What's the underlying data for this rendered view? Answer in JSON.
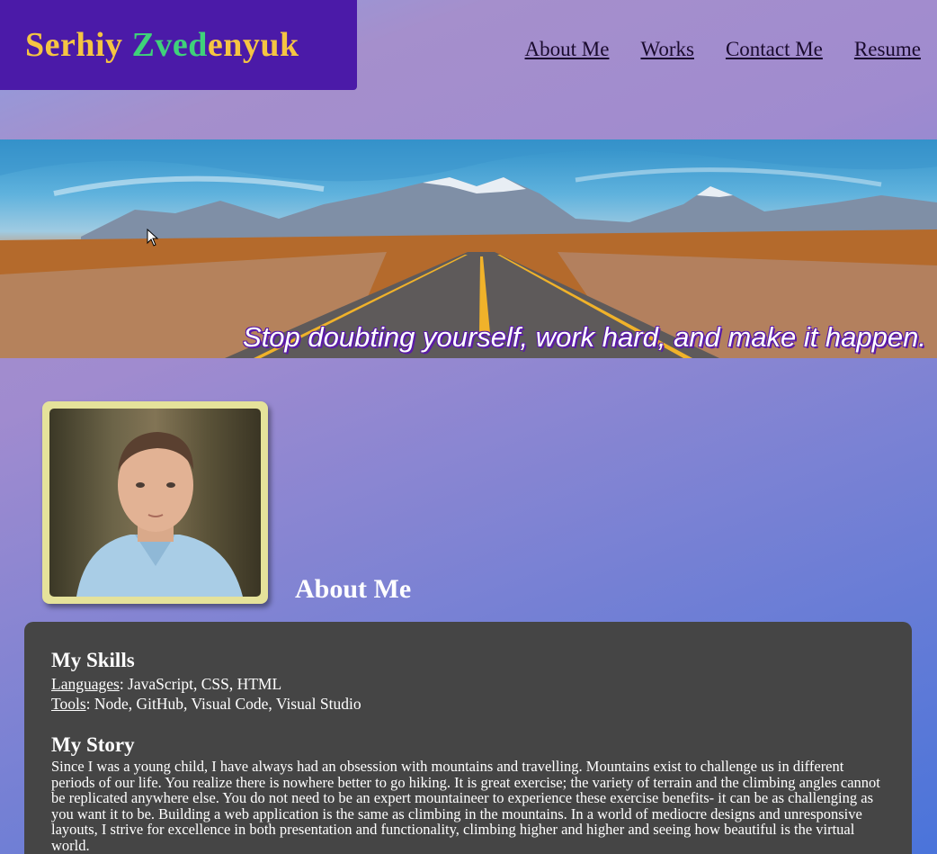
{
  "header": {
    "brand_first": "Serhiy",
    "brand_last_a": "Zved",
    "brand_last_b": "enyuk",
    "nav": [
      "About Me",
      "Works",
      "Contact Me",
      "Resume"
    ]
  },
  "hero": {
    "tagline": "Stop doubting yourself, work hard, and make it happen."
  },
  "about": {
    "heading": "About Me",
    "skills_title": "My Skills",
    "languages_label": "Languages",
    "languages_value": ": JavaScript, CSS, HTML",
    "tools_label": "Tools",
    "tools_value": ": Node, GitHub, Visual Code, Visual Studio",
    "story_title": "My Story",
    "story_text": "Since I was a young child, I have always had an obsession with mountains and travelling. Mountains exist to challenge us in different periods of our life. You realize there is nowhere better to go hiking. It is great exercise; the variety of terrain and the climbing angles cannot be replicated anywhere else. You do not need to be an expert mountaineer to experience these exercise benefits- it can be as challenging as you want it to be. Building a web application is the same as climbing in the mountains. In a world of mediocre designs and unresponsive layouts, I strive for excellence in both presentation and functionality, climbing higher and higher and seeing how beautiful is the virtual world."
  },
  "colors": {
    "brand_bg": "#4b1aa8",
    "brand_yellow": "#f5c542",
    "brand_green": "#3fd17a",
    "card_bg": "#454545",
    "frame": "#e5e29a"
  }
}
